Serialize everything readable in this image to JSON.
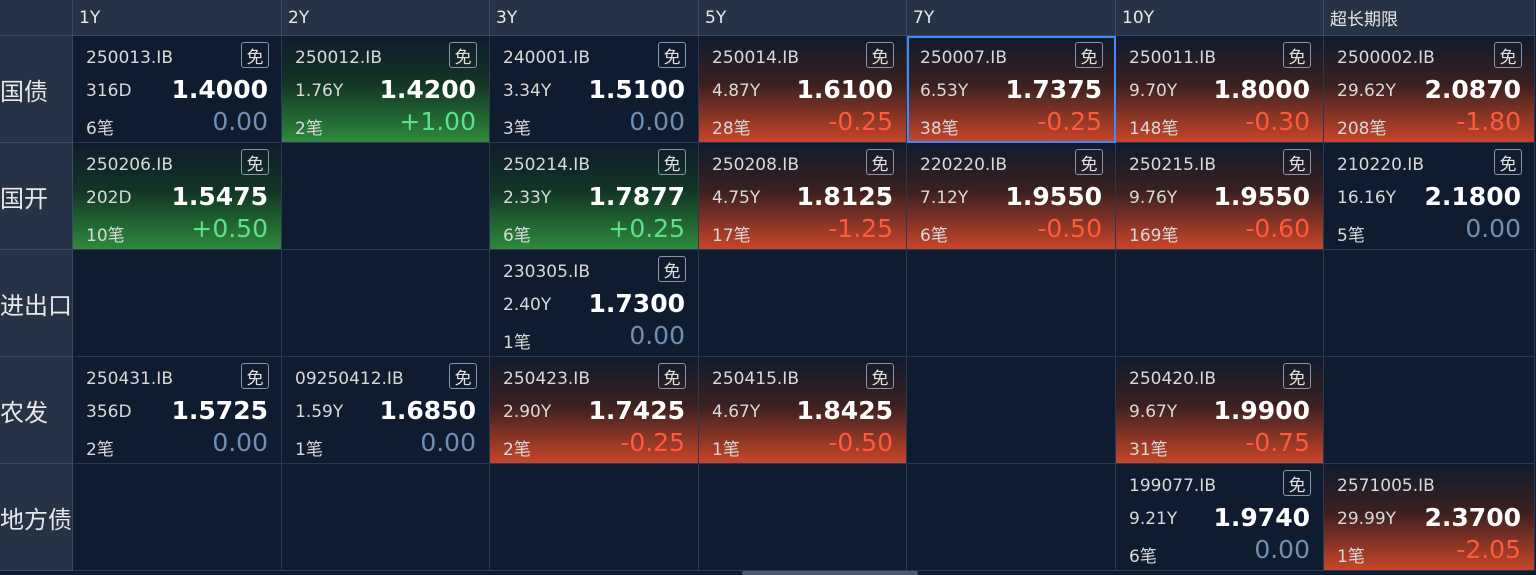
{
  "columns": [
    "1Y",
    "2Y",
    "3Y",
    "5Y",
    "7Y",
    "10Y",
    "超长期限"
  ],
  "rows": [
    {
      "label": "国债",
      "cells": [
        {
          "code": "250013.IB",
          "tag": "免",
          "term": "316D",
          "price": "1.4000",
          "count": "6笔",
          "change": "0.00",
          "trend": "flat"
        },
        {
          "code": "250012.IB",
          "tag": "免",
          "term": "1.76Y",
          "price": "1.4200",
          "count": "2笔",
          "change": "+1.00",
          "trend": "up"
        },
        {
          "code": "240001.IB",
          "tag": "免",
          "term": "3.34Y",
          "price": "1.5100",
          "count": "3笔",
          "change": "0.00",
          "trend": "flat"
        },
        {
          "code": "250014.IB",
          "tag": "免",
          "term": "4.87Y",
          "price": "1.6100",
          "count": "28笔",
          "change": "-0.25",
          "trend": "down"
        },
        {
          "code": "250007.IB",
          "tag": "免",
          "term": "6.53Y",
          "price": "1.7375",
          "count": "38笔",
          "change": "-0.25",
          "trend": "down",
          "selected": true
        },
        {
          "code": "250011.IB",
          "tag": "免",
          "term": "9.70Y",
          "price": "1.8000",
          "count": "148笔",
          "change": "-0.30",
          "trend": "down"
        },
        {
          "code": "2500002.IB",
          "tag": "免",
          "term": "29.62Y",
          "price": "2.0870",
          "count": "208笔",
          "change": "-1.80",
          "trend": "down"
        }
      ]
    },
    {
      "label": "国开",
      "cells": [
        {
          "code": "250206.IB",
          "tag": "免",
          "term": "202D",
          "price": "1.5475",
          "count": "10笔",
          "change": "+0.50",
          "trend": "up"
        },
        null,
        {
          "code": "250214.IB",
          "tag": "免",
          "term": "2.33Y",
          "price": "1.7877",
          "count": "6笔",
          "change": "+0.25",
          "trend": "up"
        },
        {
          "code": "250208.IB",
          "tag": "免",
          "term": "4.75Y",
          "price": "1.8125",
          "count": "17笔",
          "change": "-1.25",
          "trend": "down"
        },
        {
          "code": "220220.IB",
          "tag": "免",
          "term": "7.12Y",
          "price": "1.9550",
          "count": "6笔",
          "change": "-0.50",
          "trend": "down"
        },
        {
          "code": "250215.IB",
          "tag": "免",
          "term": "9.76Y",
          "price": "1.9550",
          "count": "169笔",
          "change": "-0.60",
          "trend": "down"
        },
        {
          "code": "210220.IB",
          "tag": "免",
          "term": "16.16Y",
          "price": "2.1800",
          "count": "5笔",
          "change": "0.00",
          "trend": "flat"
        }
      ]
    },
    {
      "label": "进出口行",
      "cells": [
        null,
        null,
        {
          "code": "230305.IB",
          "tag": "免",
          "term": "2.40Y",
          "price": "1.7300",
          "count": "1笔",
          "change": "0.00",
          "trend": "flat"
        },
        null,
        null,
        null,
        null
      ]
    },
    {
      "label": "农发",
      "cells": [
        {
          "code": "250431.IB",
          "tag": "免",
          "term": "356D",
          "price": "1.5725",
          "count": "2笔",
          "change": "0.00",
          "trend": "flat"
        },
        {
          "code": "09250412.IB",
          "tag": "免",
          "term": "1.59Y",
          "price": "1.6850",
          "count": "1笔",
          "change": "0.00",
          "trend": "flat"
        },
        {
          "code": "250423.IB",
          "tag": "免",
          "term": "2.90Y",
          "price": "1.7425",
          "count": "2笔",
          "change": "-0.25",
          "trend": "down"
        },
        {
          "code": "250415.IB",
          "tag": "免",
          "term": "4.67Y",
          "price": "1.8425",
          "count": "1笔",
          "change": "-0.50",
          "trend": "down"
        },
        null,
        {
          "code": "250420.IB",
          "tag": "免",
          "term": "9.67Y",
          "price": "1.9900",
          "count": "31笔",
          "change": "-0.75",
          "trend": "down"
        },
        null
      ]
    },
    {
      "label": "地方债",
      "cells": [
        null,
        null,
        null,
        null,
        null,
        {
          "code": "199077.IB",
          "tag": "免",
          "term": "9.21Y",
          "price": "1.9740",
          "count": "6笔",
          "change": "0.00",
          "trend": "flat"
        },
        {
          "code": "2571005.IB",
          "tag": "",
          "term": "29.99Y",
          "price": "2.3700",
          "count": "1笔",
          "change": "-2.05",
          "trend": "down"
        }
      ]
    }
  ]
}
